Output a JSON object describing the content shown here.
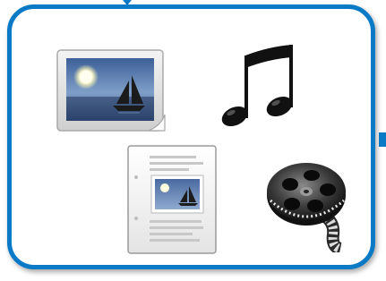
{
  "panel": {
    "border_color": "#0a79c6"
  },
  "icons": [
    {
      "name": "image-icon"
    },
    {
      "name": "music-note-icon"
    },
    {
      "name": "document-icon"
    },
    {
      "name": "film-reel-icon"
    }
  ]
}
